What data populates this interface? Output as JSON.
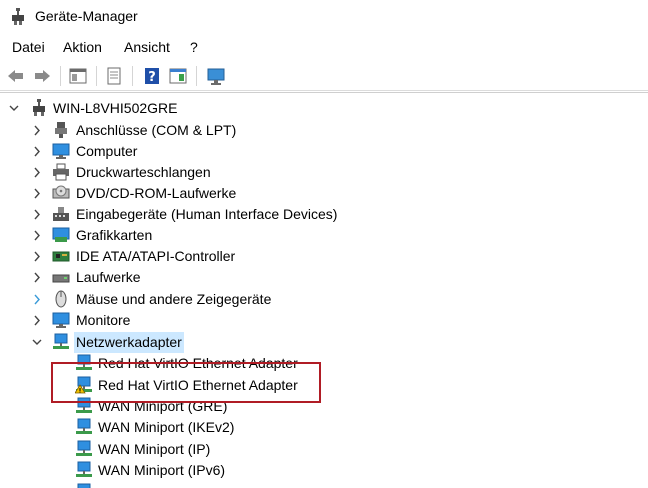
{
  "window": {
    "title": "Geräte-Manager"
  },
  "menu": {
    "items": [
      "Datei",
      "Aktion",
      "Ansicht",
      "?"
    ]
  },
  "tree": {
    "root": "WIN-L8VHI502GRE",
    "categories": [
      {
        "label": "Anschlüsse (COM & LPT)",
        "icon": "port-icon"
      },
      {
        "label": "Computer",
        "icon": "computer-icon"
      },
      {
        "label": "Druckwarteschlangen",
        "icon": "printer-icon"
      },
      {
        "label": "DVD/CD-ROM-Laufwerke",
        "icon": "dvd-drive-icon"
      },
      {
        "label": "Eingabegeräte (Human Interface Devices)",
        "icon": "hid-icon"
      },
      {
        "label": "Grafikkarten",
        "icon": "display-adapter-icon"
      },
      {
        "label": "IDE ATA/ATAPI-Controller",
        "icon": "ide-controller-icon"
      },
      {
        "label": "Laufwerke",
        "icon": "disk-drive-icon"
      },
      {
        "label": "Mäuse und andere Zeigegeräte",
        "icon": "mouse-icon"
      },
      {
        "label": "Monitore",
        "icon": "monitor-icon"
      },
      {
        "label": "Netzwerkadapter",
        "icon": "network-adapter-icon"
      }
    ],
    "network_children": [
      {
        "label": "Red Hat VirtIO Ethernet Adapter",
        "warning": false
      },
      {
        "label": "Red Hat VirtIO Ethernet Adapter",
        "warning": true
      },
      {
        "label": "WAN Miniport (GRE)",
        "warning": false
      },
      {
        "label": "WAN Miniport (IKEv2)",
        "warning": false
      },
      {
        "label": "WAN Miniport (IP)",
        "warning": false
      },
      {
        "label": "WAN Miniport (IPv6)",
        "warning": false
      }
    ]
  },
  "colors": {
    "selection": "#cce8ff",
    "highlight_border": "#b01c25",
    "accent_blue": "#2a8ad4"
  }
}
